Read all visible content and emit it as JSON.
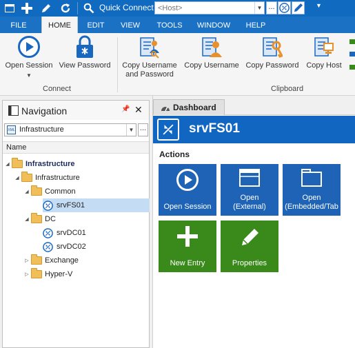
{
  "quick_access": {
    "quick_connect_label": "Quick Connect",
    "host_placeholder": "<Host>",
    "more_label": "..."
  },
  "tabs": [
    {
      "label": "FILE"
    },
    {
      "label": "HOME",
      "active": true
    },
    {
      "label": "EDIT"
    },
    {
      "label": "VIEW"
    },
    {
      "label": "TOOLS"
    },
    {
      "label": "WINDOW"
    },
    {
      "label": "HELP"
    }
  ],
  "ribbon": {
    "connect_group_label": "Connect",
    "clipboard_group_label": "Clipboard",
    "buttons": {
      "open_session": "Open Session",
      "view_password": "View Password",
      "copy_username_and_password_1": "Copy Username",
      "copy_username_and_password_2": "and Password",
      "copy_username": "Copy Username",
      "copy_password": "Copy Password",
      "copy_host": "Copy Host"
    }
  },
  "navigation": {
    "title": "Navigation",
    "data_source": "Infrastructure",
    "column_header": "Name",
    "tree": [
      {
        "label": "Infrastructure",
        "type": "folder",
        "expanded": true
      },
      {
        "label": "Infrastructure",
        "type": "folder",
        "expanded": true
      },
      {
        "label": "Common",
        "type": "folder",
        "expanded": true
      },
      {
        "label": "srvFS01",
        "type": "session",
        "selected": true
      },
      {
        "label": "DC",
        "type": "folder",
        "expanded": true
      },
      {
        "label": "srvDC01",
        "type": "session"
      },
      {
        "label": "srvDC02",
        "type": "session"
      },
      {
        "label": "Exchange",
        "type": "folder",
        "expanded": false
      },
      {
        "label": "Hyper-V",
        "type": "folder",
        "expanded": false
      }
    ]
  },
  "dashboard": {
    "tab_label": "Dashboard",
    "entry_name": "srvFS01",
    "actions_label": "Actions",
    "tiles": {
      "open_session": {
        "line1": "Open Session"
      },
      "open_external": {
        "line1": "Open",
        "line2": "(External)"
      },
      "open_embedded": {
        "line1": "Open",
        "line2": "(Embedded/Tab"
      },
      "new_entry": {
        "line1": "New Entry"
      },
      "properties": {
        "line1": "Properties"
      }
    }
  },
  "colors": {
    "title_blue": "#0f6ac0",
    "tile_blue": "#1f63b7",
    "tile_green": "#3a8a1b",
    "folder": "#f0bf5a"
  }
}
